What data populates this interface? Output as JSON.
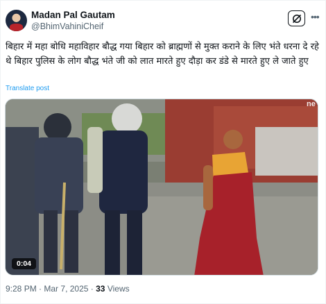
{
  "author": {
    "name": "Madan Pal Gautam",
    "handle": "@BhimVahiniCheif"
  },
  "icons": {
    "grok": "grok-icon",
    "more": "more-dots-icon",
    "verified": "none"
  },
  "post": {
    "text": "बिहार में महा बोधि महाविहार बौद्ध गया बिहार को ब्राह्मणों से मुक्त कराने के लिए भंते धरना दे रहे थे बिहार पुलिस के लोग बौद्ध भंते जी को लात मारते हुए दौड़ा कर डंडे से मारते हुए ले जाते हुए",
    "translate_label": "Translate post"
  },
  "media": {
    "type": "video",
    "duration": "0:04",
    "watermark": "ne"
  },
  "footer": {
    "time": "9:28 PM",
    "separator": "·",
    "date": "Mar 7, 2025",
    "views_count": "33",
    "views_label": "Views"
  },
  "colors": {
    "text": "#0f1419",
    "secondary": "#536471",
    "link": "#1d9bf0"
  }
}
